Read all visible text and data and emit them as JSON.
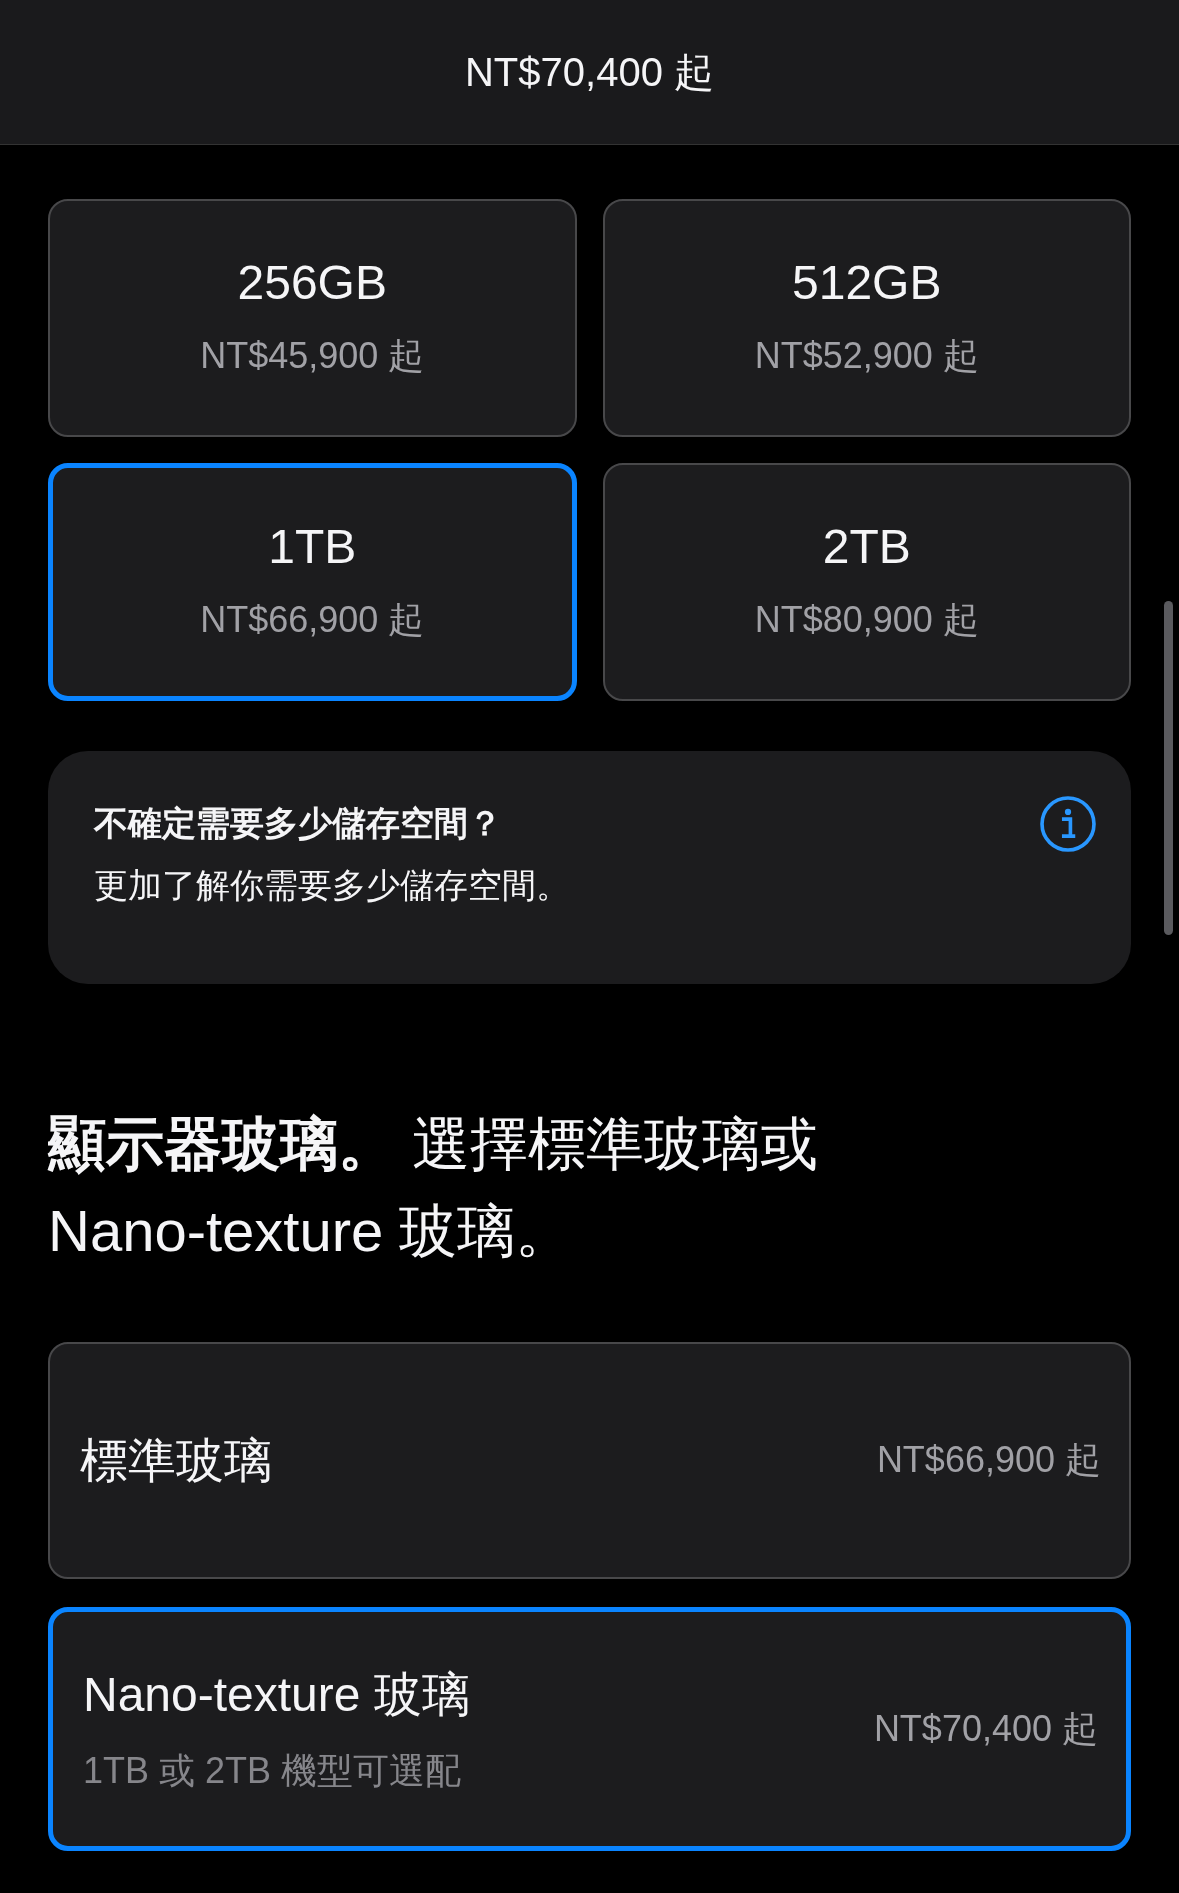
{
  "header": {
    "title": "NT$70,400 起"
  },
  "storage_options": [
    {
      "capacity": "256GB",
      "price": "NT$45,900 起",
      "selected": false
    },
    {
      "capacity": "512GB",
      "price": "NT$52,900 起",
      "selected": false
    },
    {
      "capacity": "1TB",
      "price": "NT$66,900 起",
      "selected": true
    },
    {
      "capacity": "2TB",
      "price": "NT$80,900 起",
      "selected": false
    }
  ],
  "storage_help": {
    "title": "不確定需要多少儲存空間？",
    "link": "更加了解你需要多少儲存空間。"
  },
  "glass_section": {
    "heading": "**顯示器玻璃。** 選擇標準玻璃或 Nano-texture 玻璃。"
  },
  "glass_options": [
    {
      "name": "標準玻璃",
      "price": "NT$66,900 起",
      "selected": false
    },
    {
      "name": "Nano-texture 玻璃",
      "note": "1TB 或 2TB 機型可選配",
      "price": "NT$70,400 起",
      "selected": true
    }
  ]
}
